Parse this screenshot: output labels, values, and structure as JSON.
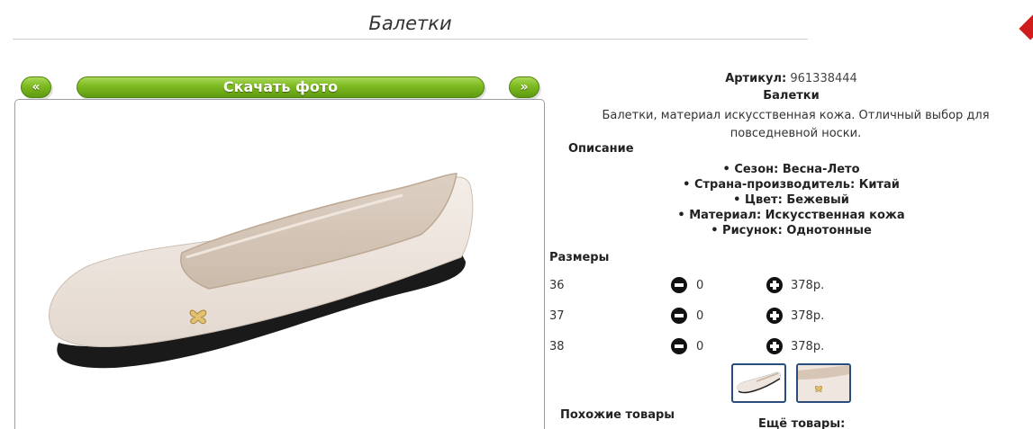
{
  "page": {
    "title": "Балетки"
  },
  "gallery": {
    "prev_label": "«",
    "download_label": "Скачать фото",
    "next_label": "»"
  },
  "product": {
    "sku_label": "Артикул:",
    "sku_value": "961338444",
    "name": "Балетки",
    "description": "Балетки, материал искусственная кожа. Отличный выбор для повседневной носки.",
    "desc_heading": "Описание",
    "properties": [
      "Сезон: Весна-Лето",
      "Страна-производитель: Китай",
      "Цвет: Бежевый",
      "Материал: Искусственная кожа",
      "Рисунок: Однотонные"
    ]
  },
  "sizes": {
    "heading": "Размеры",
    "rows": [
      {
        "size": "36",
        "qty": "0",
        "price": "378р."
      },
      {
        "size": "37",
        "qty": "0",
        "price": "378р."
      },
      {
        "size": "38",
        "qty": "0",
        "price": "378р."
      }
    ]
  },
  "related": {
    "similar_label": "Похожие товары",
    "more_label": "Ещё товары:"
  },
  "colors": {
    "accent_green": "#7db921",
    "thumb_border": "#2b4d7e",
    "brand_red": "#d01c1c"
  }
}
